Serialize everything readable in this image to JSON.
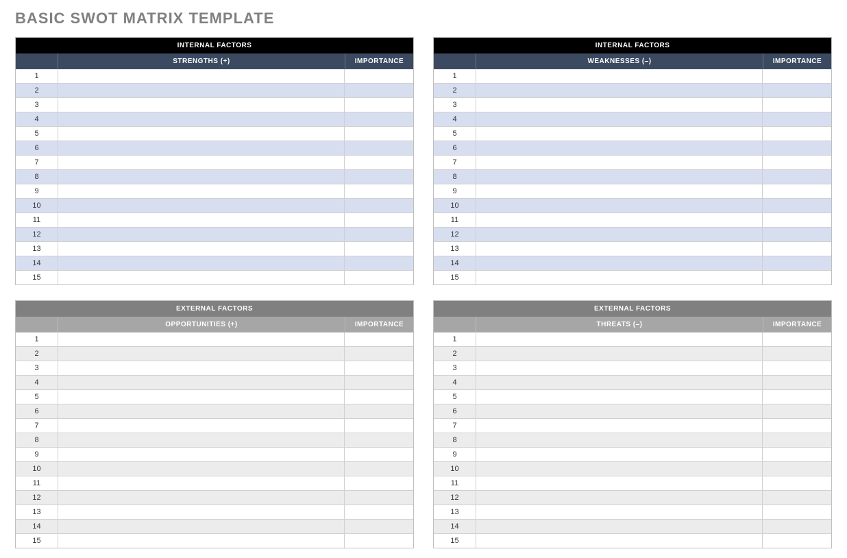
{
  "title": "BASIC SWOT MATRIX TEMPLATE",
  "row_count": 15,
  "quadrants": [
    {
      "key": "strengths",
      "zone": "internal",
      "factor_label": "INTERNAL FACTORS",
      "column_label": "STRENGTHS (+)",
      "importance_label": "IMPORTANCE",
      "rows": [
        {
          "n": "1",
          "text": "",
          "importance": ""
        },
        {
          "n": "2",
          "text": "",
          "importance": ""
        },
        {
          "n": "3",
          "text": "",
          "importance": ""
        },
        {
          "n": "4",
          "text": "",
          "importance": ""
        },
        {
          "n": "5",
          "text": "",
          "importance": ""
        },
        {
          "n": "6",
          "text": "",
          "importance": ""
        },
        {
          "n": "7",
          "text": "",
          "importance": ""
        },
        {
          "n": "8",
          "text": "",
          "importance": ""
        },
        {
          "n": "9",
          "text": "",
          "importance": ""
        },
        {
          "n": "10",
          "text": "",
          "importance": ""
        },
        {
          "n": "11",
          "text": "",
          "importance": ""
        },
        {
          "n": "12",
          "text": "",
          "importance": ""
        },
        {
          "n": "13",
          "text": "",
          "importance": ""
        },
        {
          "n": "14",
          "text": "",
          "importance": ""
        },
        {
          "n": "15",
          "text": "",
          "importance": ""
        }
      ]
    },
    {
      "key": "weaknesses",
      "zone": "internal",
      "factor_label": "INTERNAL FACTORS",
      "column_label": "WEAKNESSES (–)",
      "importance_label": "IMPORTANCE",
      "rows": [
        {
          "n": "1",
          "text": "",
          "importance": ""
        },
        {
          "n": "2",
          "text": "",
          "importance": ""
        },
        {
          "n": "3",
          "text": "",
          "importance": ""
        },
        {
          "n": "4",
          "text": "",
          "importance": ""
        },
        {
          "n": "5",
          "text": "",
          "importance": ""
        },
        {
          "n": "6",
          "text": "",
          "importance": ""
        },
        {
          "n": "7",
          "text": "",
          "importance": ""
        },
        {
          "n": "8",
          "text": "",
          "importance": ""
        },
        {
          "n": "9",
          "text": "",
          "importance": ""
        },
        {
          "n": "10",
          "text": "",
          "importance": ""
        },
        {
          "n": "11",
          "text": "",
          "importance": ""
        },
        {
          "n": "12",
          "text": "",
          "importance": ""
        },
        {
          "n": "13",
          "text": "",
          "importance": ""
        },
        {
          "n": "14",
          "text": "",
          "importance": ""
        },
        {
          "n": "15",
          "text": "",
          "importance": ""
        }
      ]
    },
    {
      "key": "opportunities",
      "zone": "external",
      "factor_label": "EXTERNAL FACTORS",
      "column_label": "OPPORTUNITIES (+)",
      "importance_label": "IMPORTANCE",
      "rows": [
        {
          "n": "1",
          "text": "",
          "importance": ""
        },
        {
          "n": "2",
          "text": "",
          "importance": ""
        },
        {
          "n": "3",
          "text": "",
          "importance": ""
        },
        {
          "n": "4",
          "text": "",
          "importance": ""
        },
        {
          "n": "5",
          "text": "",
          "importance": ""
        },
        {
          "n": "6",
          "text": "",
          "importance": ""
        },
        {
          "n": "7",
          "text": "",
          "importance": ""
        },
        {
          "n": "8",
          "text": "",
          "importance": ""
        },
        {
          "n": "9",
          "text": "",
          "importance": ""
        },
        {
          "n": "10",
          "text": "",
          "importance": ""
        },
        {
          "n": "11",
          "text": "",
          "importance": ""
        },
        {
          "n": "12",
          "text": "",
          "importance": ""
        },
        {
          "n": "13",
          "text": "",
          "importance": ""
        },
        {
          "n": "14",
          "text": "",
          "importance": ""
        },
        {
          "n": "15",
          "text": "",
          "importance": ""
        }
      ]
    },
    {
      "key": "threats",
      "zone": "external",
      "factor_label": "EXTERNAL FACTORS",
      "column_label": "THREATS (–)",
      "importance_label": "IMPORTANCE",
      "rows": [
        {
          "n": "1",
          "text": "",
          "importance": ""
        },
        {
          "n": "2",
          "text": "",
          "importance": ""
        },
        {
          "n": "3",
          "text": "",
          "importance": ""
        },
        {
          "n": "4",
          "text": "",
          "importance": ""
        },
        {
          "n": "5",
          "text": "",
          "importance": ""
        },
        {
          "n": "6",
          "text": "",
          "importance": ""
        },
        {
          "n": "7",
          "text": "",
          "importance": ""
        },
        {
          "n": "8",
          "text": "",
          "importance": ""
        },
        {
          "n": "9",
          "text": "",
          "importance": ""
        },
        {
          "n": "10",
          "text": "",
          "importance": ""
        },
        {
          "n": "11",
          "text": "",
          "importance": ""
        },
        {
          "n": "12",
          "text": "",
          "importance": ""
        },
        {
          "n": "13",
          "text": "",
          "importance": ""
        },
        {
          "n": "14",
          "text": "",
          "importance": ""
        },
        {
          "n": "15",
          "text": "",
          "importance": ""
        }
      ]
    }
  ]
}
